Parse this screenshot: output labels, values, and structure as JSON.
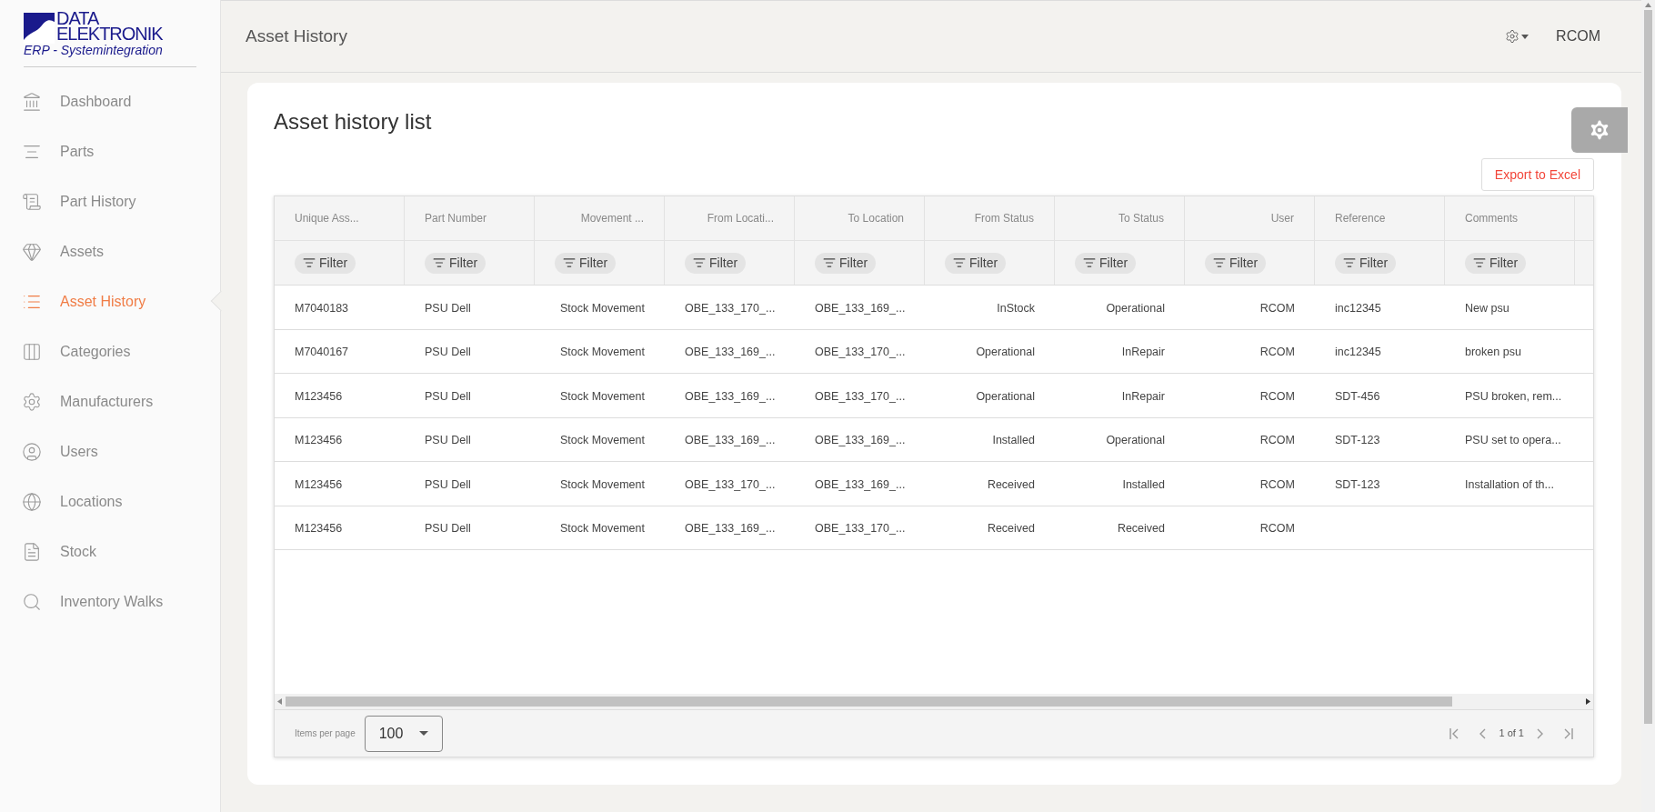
{
  "logo": {
    "line1": "DATA",
    "line2": "ELEKTRONIK",
    "tagline": "ERP - Systemintegration"
  },
  "sidebar": {
    "items": [
      {
        "label": "Dashboard",
        "selected": false
      },
      {
        "label": "Parts",
        "selected": false
      },
      {
        "label": "Part History",
        "selected": false
      },
      {
        "label": "Assets",
        "selected": false
      },
      {
        "label": "Asset History",
        "selected": true
      },
      {
        "label": "Categories",
        "selected": false
      },
      {
        "label": "Manufacturers",
        "selected": false
      },
      {
        "label": "Users",
        "selected": false
      },
      {
        "label": "Locations",
        "selected": false
      },
      {
        "label": "Stock",
        "selected": false
      },
      {
        "label": "Inventory Walks",
        "selected": false
      }
    ]
  },
  "header": {
    "title": "Asset History",
    "user": "RCOM"
  },
  "card": {
    "title": "Asset history list",
    "export_button": "Export to Excel"
  },
  "table": {
    "columns": [
      "Unique Ass...",
      "Part Number",
      "Movement ...",
      "From Locati...",
      "To Location",
      "From Status",
      "To Status",
      "User",
      "Reference",
      "Comments"
    ],
    "filters": [
      "Filter",
      "Filter",
      "Filter",
      "Filter",
      "Filter",
      "Filter",
      "Filter",
      "Filter",
      "Filter",
      "Filter"
    ],
    "rows": [
      [
        "M7040183",
        "PSU Dell",
        "Stock Movement",
        "OBE_133_170_...",
        "OBE_133_169_...",
        "InStock",
        "Operational",
        "RCOM",
        "inc12345",
        "New psu"
      ],
      [
        "M7040167",
        "PSU Dell",
        "Stock Movement",
        "OBE_133_169_...",
        "OBE_133_170_...",
        "Operational",
        "InRepair",
        "RCOM",
        "inc12345",
        "broken psu"
      ],
      [
        "M123456",
        "PSU Dell",
        "Stock Movement",
        "OBE_133_169_...",
        "OBE_133_170_...",
        "Operational",
        "InRepair",
        "RCOM",
        "SDT-456",
        "PSU broken, rem..."
      ],
      [
        "M123456",
        "PSU Dell",
        "Stock Movement",
        "OBE_133_169_...",
        "OBE_133_169_...",
        "Installed",
        "Operational",
        "RCOM",
        "SDT-123",
        "PSU set to opera..."
      ],
      [
        "M123456",
        "PSU Dell",
        "Stock Movement",
        "OBE_133_170_...",
        "OBE_133_169_...",
        "Received",
        "Installed",
        "RCOM",
        "SDT-123",
        "Installation of th..."
      ],
      [
        "M123456",
        "PSU Dell",
        "Stock Movement",
        "OBE_133_169_...",
        "OBE_133_170_...",
        "Received",
        "Received",
        "RCOM",
        null,
        null
      ]
    ]
  },
  "pager": {
    "items_label": "Items per page",
    "page_size": "100",
    "page_info": "1 of 1"
  }
}
